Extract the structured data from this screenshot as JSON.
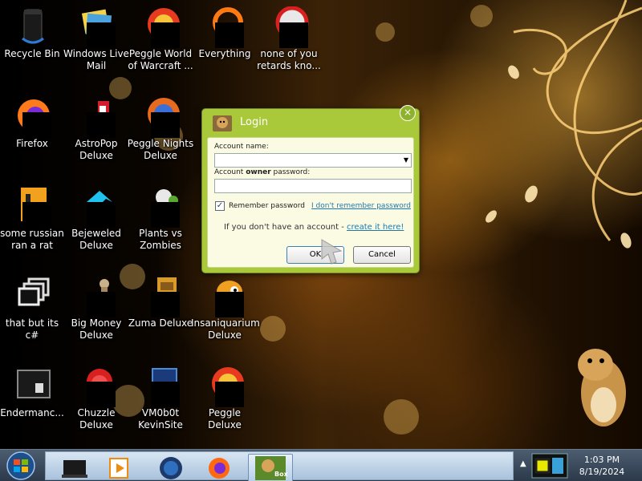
{
  "desktop": {
    "icons": [
      {
        "label": "Recycle Bin",
        "icon": "recycle-bin-icon"
      },
      {
        "label": "Windows Live Mail",
        "icon": "mail-icon"
      },
      {
        "label": "Peggle World of Warcraft ...",
        "icon": "peggle-wow-icon"
      },
      {
        "label": "Everything",
        "icon": "everything-icon"
      },
      {
        "label": "none of you retards kno...",
        "icon": "circle-app-icon"
      },
      {
        "label": "Firefox",
        "icon": "firefox-icon"
      },
      {
        "label": "AstroPop Deluxe",
        "icon": "astropop-icon"
      },
      {
        "label": "Peggle Nights Deluxe",
        "icon": "peggle-nights-icon"
      },
      {
        "label": "some russian ran a rat",
        "icon": "java-file-icon"
      },
      {
        "label": "Bejeweled Deluxe",
        "icon": "bejeweled-icon"
      },
      {
        "label": "Plants vs Zombies",
        "icon": "pvz-icon"
      },
      {
        "label": "that but its c#",
        "icon": "stacked-windows-icon"
      },
      {
        "label": "Big Money Deluxe",
        "icon": "big-money-icon"
      },
      {
        "label": "Zuma Deluxe",
        "icon": "zuma-icon"
      },
      {
        "label": "Insaniquarium Deluxe",
        "icon": "insaniquarium-icon"
      },
      {
        "label": "Endermanc...",
        "icon": "terminal-icon"
      },
      {
        "label": "Chuzzle Deluxe",
        "icon": "chuzzle-icon"
      },
      {
        "label": "VM0b0t KevinSite",
        "icon": "vm-icon"
      },
      {
        "label": "Peggle Deluxe",
        "icon": "peggle-icon"
      }
    ]
  },
  "login": {
    "title": "Login",
    "close": "×",
    "account_name_label": "Account name:",
    "account_name_value": "",
    "password_label_pre": "Account ",
    "password_label_bold": "owner",
    "password_label_post": " password:",
    "password_value": "",
    "remember_checked": true,
    "remember_label": "Remember password",
    "forgot_link": "I don't remember password",
    "no_account_text": "If you don't have an account - ",
    "create_link": "create it here!",
    "ok_label": "OK",
    "cancel_label": "Cancel"
  },
  "taskbar": {
    "pinned": [
      "notebook-icon",
      "media-player-icon",
      "globe-icon",
      "firefox-icon",
      "box-game-icon"
    ],
    "active_label": "Box",
    "tray_icons": [
      "show-hidden-icons",
      "vm-tray-icon"
    ],
    "time": "1:03 PM",
    "date": "8/19/2024"
  },
  "colors": {
    "dialog_green": "#a9c83a",
    "link_blue": "#1a7ab0",
    "taskbar": "#2b394a"
  }
}
